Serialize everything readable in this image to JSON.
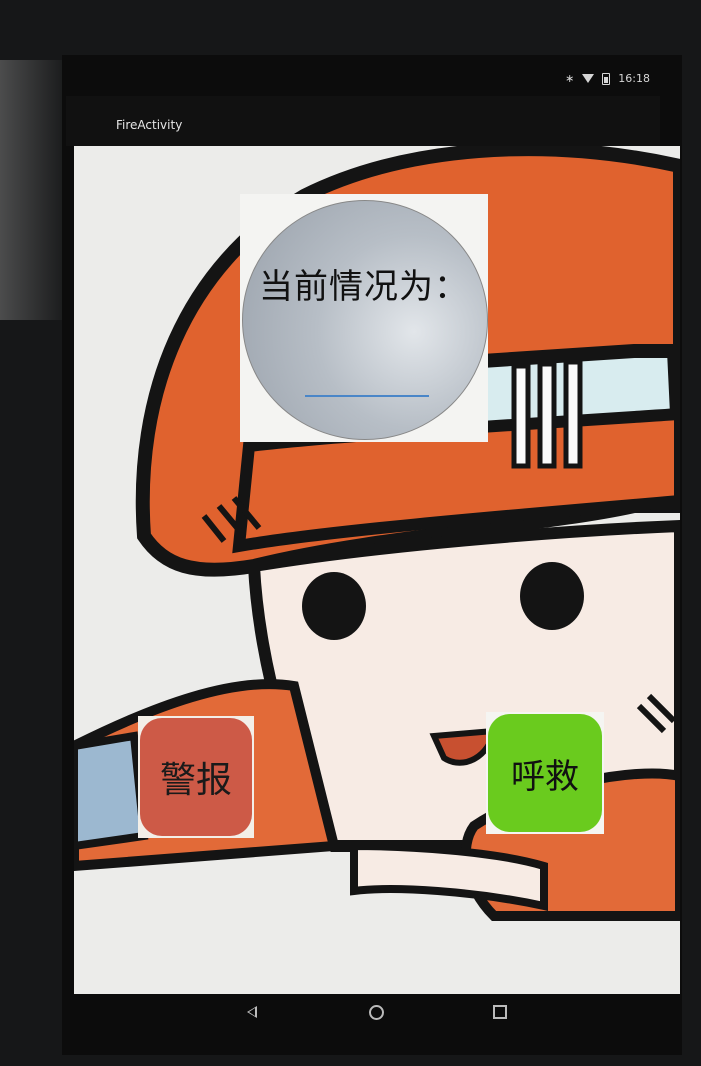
{
  "status_bar": {
    "time": "16:18",
    "icons": [
      "bluetooth-icon",
      "wifi-icon",
      "battery-icon"
    ]
  },
  "app_bar": {
    "title": "FireActivity"
  },
  "status_panel": {
    "label": "当前情况为：",
    "value": ""
  },
  "buttons": {
    "alarm_label": "警报",
    "help_label": "呼救"
  },
  "navigation": {
    "icons": [
      "back-icon",
      "home-icon",
      "recents-icon"
    ]
  },
  "colors": {
    "alarm_button": "#cd5a47",
    "help_button": "#6acb1e",
    "input_underline": "#4a86c8",
    "helmet": "#e0622e"
  }
}
